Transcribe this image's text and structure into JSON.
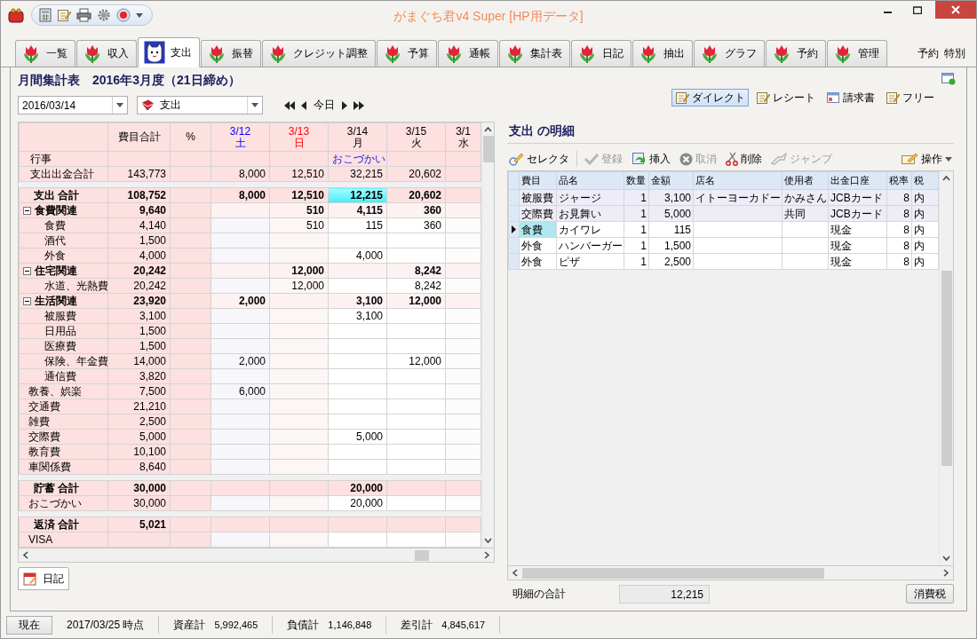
{
  "window": {
    "title": "がまぐち君v4 Super [HP用データ]"
  },
  "tabs": [
    {
      "label": "一覧",
      "selected": false
    },
    {
      "label": "収入",
      "selected": false
    },
    {
      "label": "支出",
      "selected": true
    },
    {
      "label": "振替",
      "selected": false
    },
    {
      "label": "クレジット調整",
      "selected": false
    },
    {
      "label": "予算",
      "selected": false
    },
    {
      "label": "通帳",
      "selected": false
    },
    {
      "label": "集計表",
      "selected": false
    },
    {
      "label": "日記",
      "selected": false
    },
    {
      "label": "抽出",
      "selected": false
    },
    {
      "label": "グラフ",
      "selected": false
    },
    {
      "label": "予約",
      "selected": false
    },
    {
      "label": "管理",
      "selected": false
    }
  ],
  "tab_extras": [
    "予約",
    "特別"
  ],
  "report": {
    "title": "月間集計表",
    "period": "2016年3月度（21日締め）",
    "date": "2016/03/14",
    "category": "支出",
    "today": "今日"
  },
  "views": [
    {
      "label": "ダイレクト",
      "selected": true
    },
    {
      "label": "レシート",
      "selected": false
    },
    {
      "label": "請求書",
      "selected": false
    },
    {
      "label": "フリー",
      "selected": false
    }
  ],
  "summary": {
    "columns": [
      {
        "kind": "text"
      },
      {
        "kind": "text",
        "label": "費目合計"
      },
      {
        "kind": "text",
        "label": "%"
      },
      {
        "kind": "date",
        "date": "3/12",
        "day": "土",
        "color": "#0000ff"
      },
      {
        "kind": "date",
        "date": "3/13",
        "day": "日",
        "color": "#ff0000"
      },
      {
        "kind": "date",
        "date": "3/14",
        "day": "月",
        "color": "#000000"
      },
      {
        "kind": "date",
        "date": "3/15",
        "day": "火",
        "color": "#000000"
      },
      {
        "kind": "date",
        "date": "3/1",
        "day": "水",
        "color": "#000000"
      }
    ],
    "rows": [
      {
        "kind": "event",
        "label": "行事",
        "cells": [
          "",
          "",
          "",
          "",
          "おこづかい",
          "",
          ""
        ]
      },
      {
        "kind": "sum",
        "label": "支出出金合計",
        "cells": [
          "143,773",
          "",
          "8,000",
          "12,510",
          "32,215",
          "20,602",
          ""
        ]
      },
      {
        "kind": "gap"
      },
      {
        "kind": "total",
        "label": "支出 合計",
        "cells": [
          "108,752",
          "",
          "8,000",
          "12,510",
          {
            "text": "12,215",
            "selected": true
          },
          "20,602",
          ""
        ]
      },
      {
        "kind": "group",
        "label": "食費関連",
        "expanded": true,
        "cells": [
          "9,640",
          "",
          "",
          "510",
          "4,115",
          "360",
          ""
        ],
        "children": [
          {
            "kind": "item",
            "label": "食費",
            "cells": [
              "4,140",
              "",
              "",
              "510",
              "115",
              "360",
              ""
            ]
          },
          {
            "kind": "item",
            "label": "酒代",
            "cells": [
              "1,500",
              "",
              "",
              "",
              "",
              "",
              ""
            ]
          },
          {
            "kind": "item",
            "label": "外食",
            "cells": [
              "4,000",
              "",
              "",
              "",
              "4,000",
              "",
              ""
            ]
          }
        ]
      },
      {
        "kind": "group",
        "label": "住宅関連",
        "expanded": true,
        "cells": [
          "20,242",
          "",
          "",
          "12,000",
          "",
          "8,242",
          ""
        ],
        "children": [
          {
            "kind": "item",
            "label": "水道、光熱費",
            "cells": [
              "20,242",
              "",
              "",
              "12,000",
              "",
              "8,242",
              ""
            ]
          }
        ]
      },
      {
        "kind": "group",
        "label": "生活関連",
        "expanded": true,
        "cells": [
          "23,920",
          "",
          "2,000",
          "",
          "3,100",
          "12,000",
          ""
        ],
        "children": [
          {
            "kind": "item",
            "label": "被服費",
            "cells": [
              "3,100",
              "",
              "",
              "",
              "3,100",
              "",
              ""
            ]
          },
          {
            "kind": "item",
            "label": "日用品",
            "cells": [
              "1,500",
              "",
              "",
              "",
              "",
              "",
              ""
            ]
          },
          {
            "kind": "item",
            "label": "医療費",
            "cells": [
              "1,500",
              "",
              "",
              "",
              "",
              "",
              ""
            ]
          },
          {
            "kind": "item",
            "label": "保険、年金費",
            "cells": [
              "14,000",
              "",
              "2,000",
              "",
              "",
              "12,000",
              ""
            ]
          },
          {
            "kind": "item",
            "label": "通信費",
            "cells": [
              "3,820",
              "",
              "",
              "",
              "",
              "",
              ""
            ]
          }
        ]
      },
      {
        "kind": "item",
        "label": "教養、娯楽",
        "cells": [
          "7,500",
          "",
          "6,000",
          "",
          "",
          "",
          ""
        ]
      },
      {
        "kind": "item",
        "label": "交通費",
        "cells": [
          "21,210",
          "",
          "",
          "",
          "",
          "",
          ""
        ]
      },
      {
        "kind": "item",
        "label": "雑費",
        "cells": [
          "2,500",
          "",
          "",
          "",
          "",
          "",
          ""
        ]
      },
      {
        "kind": "item",
        "label": "交際費",
        "cells": [
          "5,000",
          "",
          "",
          "",
          "5,000",
          "",
          ""
        ]
      },
      {
        "kind": "item",
        "label": "教育費",
        "cells": [
          "10,100",
          "",
          "",
          "",
          "",
          "",
          ""
        ]
      },
      {
        "kind": "item",
        "label": "車関係費",
        "cells": [
          "8,640",
          "",
          "",
          "",
          "",
          "",
          ""
        ]
      },
      {
        "kind": "gap"
      },
      {
        "kind": "total",
        "label": "貯蓄 合計",
        "cells": [
          "30,000",
          "",
          "",
          "",
          "20,000",
          "",
          ""
        ]
      },
      {
        "kind": "item",
        "label": "おこづかい",
        "cells": [
          "30,000",
          "",
          "",
          "",
          "20,000",
          "",
          ""
        ]
      },
      {
        "kind": "gap"
      },
      {
        "kind": "total",
        "label": "返済 合計",
        "cells": [
          "5,021",
          "",
          "",
          "",
          "",
          "",
          ""
        ]
      },
      {
        "kind": "item",
        "label": "VISA",
        "cells": [
          "",
          "",
          "",
          "",
          "",
          "",
          ""
        ]
      }
    ]
  },
  "bottom_tab": {
    "label": "日記"
  },
  "detail": {
    "title": "支出 の明細",
    "toolbar": [
      {
        "kind": "button",
        "label": "セレクタ",
        "disabled": false
      },
      {
        "kind": "button",
        "label": "登録",
        "disabled": true
      },
      {
        "kind": "button",
        "label": "挿入",
        "disabled": false
      },
      {
        "kind": "button",
        "label": "取消",
        "disabled": true
      },
      {
        "kind": "button",
        "label": "削除",
        "disabled": false
      },
      {
        "kind": "button",
        "label": "ジャンプ",
        "disabled": true
      },
      {
        "kind": "menu",
        "label": "操作",
        "disabled": false
      }
    ],
    "columns": [
      "費目",
      "品名",
      "数量",
      "金額",
      "店名",
      "使用者",
      "出金口座",
      "税率",
      "税"
    ],
    "rows": [
      {
        "selected": false,
        "shaded": true,
        "cells": [
          "被服費",
          "ジャージ",
          "1",
          "3,100",
          "イトーヨーカドー",
          "かみさん",
          "JCBカード",
          "8",
          "内"
        ]
      },
      {
        "selected": false,
        "shaded": true,
        "cells": [
          "交際費",
          "お見舞い",
          "1",
          "5,000",
          "",
          "共同",
          "JCBカード",
          "8",
          "内"
        ]
      },
      {
        "selected": true,
        "shaded": false,
        "cells": [
          "食費",
          "カイワレ",
          "1",
          "115",
          "",
          "",
          "現金",
          "8",
          "内"
        ]
      },
      {
        "selected": false,
        "shaded": false,
        "cells": [
          "外食",
          "ハンバーガー",
          "1",
          "1,500",
          "",
          "",
          "現金",
          "8",
          "内"
        ]
      },
      {
        "selected": false,
        "shaded": false,
        "cells": [
          "外食",
          "ピザ",
          "1",
          "2,500",
          "",
          "",
          "現金",
          "8",
          "内"
        ]
      }
    ],
    "total_label": "明細の合計",
    "total": "12,215",
    "tax_button": "消費税"
  },
  "status_bar": {
    "now_button": "現在",
    "as_of": "2017/03/25 時点",
    "items": [
      {
        "label": "資産計",
        "value": "5,992,465"
      },
      {
        "label": "負債計",
        "value": "1,146,848"
      },
      {
        "label": "差引計",
        "value": "4,845,617"
      }
    ]
  }
}
